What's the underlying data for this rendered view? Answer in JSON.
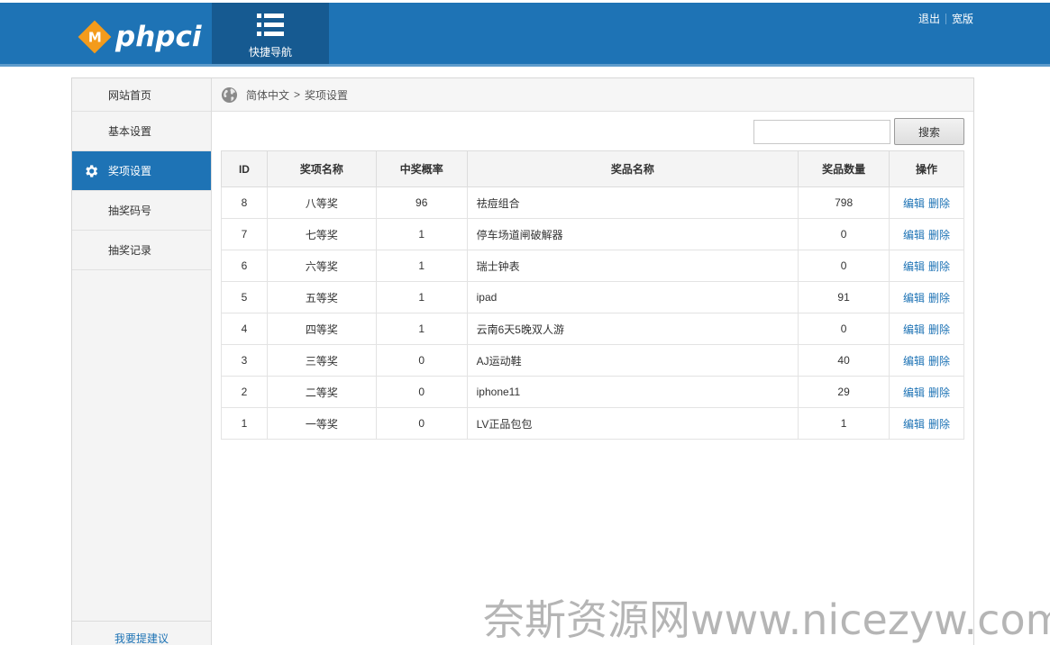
{
  "header": {
    "logo_badge": "M",
    "logo_text": "phpci",
    "quicknav_label": "快捷导航",
    "quicknav_icon": "list-icon",
    "links": [
      "退出",
      "宽版"
    ]
  },
  "colors": {
    "brand": "#1e73b5",
    "accent": "#f39b1c",
    "quicknav_bg": "#165a91"
  },
  "sidebar": {
    "items": [
      {
        "label": "网站首页",
        "active": false
      },
      {
        "label": "基本设置",
        "active": false
      },
      {
        "label": "奖项设置",
        "active": true,
        "icon": "gear-icon"
      },
      {
        "label": "抽奖码号",
        "active": false
      },
      {
        "label": "抽奖记录",
        "active": false
      }
    ],
    "feedback": "我要提建议"
  },
  "breadcrumb": {
    "icon": "globe-icon",
    "root": "简体中文",
    "separator": ">",
    "current": "奖项设置"
  },
  "search": {
    "value": "",
    "placeholder": "",
    "button_label": "搜索"
  },
  "table": {
    "headers": [
      "ID",
      "奖项名称",
      "中奖概率",
      "奖品名称",
      "奖品数量",
      "操作"
    ],
    "rows": [
      {
        "id": "8",
        "award": "八等奖",
        "probability": "96",
        "prize": "祛痘组合",
        "quantity": "798"
      },
      {
        "id": "7",
        "award": "七等奖",
        "probability": "1",
        "prize": "停车场道闸破解器",
        "quantity": "0"
      },
      {
        "id": "6",
        "award": "六等奖",
        "probability": "1",
        "prize": "瑞士钟表",
        "quantity": "0"
      },
      {
        "id": "5",
        "award": "五等奖",
        "probability": "1",
        "prize": "ipad",
        "quantity": "91"
      },
      {
        "id": "4",
        "award": "四等奖",
        "probability": "1",
        "prize": "云南6天5晚双人游",
        "quantity": "0"
      },
      {
        "id": "3",
        "award": "三等奖",
        "probability": "0",
        "prize": "AJ运动鞋",
        "quantity": "40"
      },
      {
        "id": "2",
        "award": "二等奖",
        "probability": "0",
        "prize": "iphone11",
        "quantity": "29"
      },
      {
        "id": "1",
        "award": "一等奖",
        "probability": "0",
        "prize": "LV正品包包",
        "quantity": "1"
      }
    ],
    "edit_label": "编辑",
    "delete_label": "删除"
  },
  "watermark": "奈斯资源网www.nicezyw.com"
}
